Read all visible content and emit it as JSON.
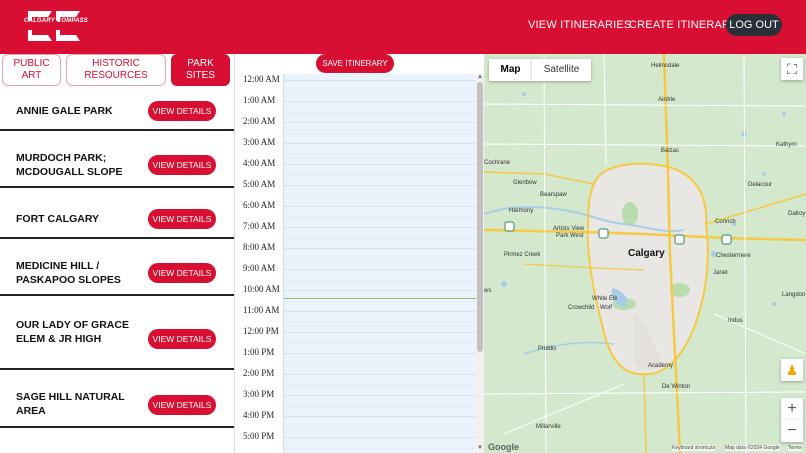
{
  "header": {
    "logo_text": "CALGARY COMPASS",
    "nav": {
      "view_itineraries": "VIEW ITINERARIES",
      "create_itinerary": "CREATE ITINERARY",
      "logout": "LOG OUT"
    },
    "colors": {
      "brand": "#d80f32",
      "logout_bg": "#2b2f3a"
    }
  },
  "tabs": [
    {
      "line1": "PUBLIC",
      "line2": "ART"
    },
    {
      "line1": "HISTORIC",
      "line2": "RESOURCES"
    },
    {
      "line1": "PARK",
      "line2": "SITES"
    }
  ],
  "sites": [
    {
      "name": "ANNIE GALE PARK",
      "button": "VIEW DETAILS"
    },
    {
      "name": "MURDOCH PARK; MCDOUGALL SLOPE",
      "button": "VIEW DETAILS"
    },
    {
      "name": "FORT CALGARY",
      "button": "VIEW DETAILS"
    },
    {
      "name": "MEDICINE HILL / PASKAPOO SLOPES",
      "button": "VIEW DETAILS"
    },
    {
      "name": "OUR LADY OF GRACE ELEM & JR HIGH",
      "button": "VIEW DETAILS"
    },
    {
      "name": "SAGE HILL NATURAL AREA",
      "button": "VIEW DETAILS"
    }
  ],
  "calendar": {
    "save_label": "SAVE ITINERARY",
    "times": [
      "12:00 AM",
      "1:00 AM",
      "2:00 AM",
      "3:00 AM",
      "4:00 AM",
      "5:00 AM",
      "6:00 AM",
      "7:00 AM",
      "8:00 AM",
      "9:00 AM",
      "10:00 AM",
      "11:00 AM",
      "12:00 PM",
      "1:00 PM",
      "2:00 PM",
      "3:00 PM",
      "4:00 PM",
      "5:00 PM"
    ]
  },
  "map": {
    "map_label": "Map",
    "satellite_label": "Satellite",
    "city": "Calgary",
    "towns": {
      "helmsdale": "Helmsdale",
      "airdrie": "Airdrie",
      "balzac": "Balzac",
      "cochrane": "Cochrane",
      "glenbow": "Glenbow",
      "bearspaw": "Bearspaw",
      "harmony": "Harmony",
      "artists_view": "Artists View",
      "park_west": "Park West",
      "pirmez_creek": "Pirmez Creek",
      "white_elk": "White Elk",
      "crowchild": "Crowchild",
      "wolf": "Wolf",
      "priddis": "Priddis",
      "academy": "Academy",
      "de_winton": "De Winton",
      "millarville": "Millarville",
      "kathyrn": "Kathyrn",
      "delacour": "Delacour",
      "conrich": "Conrich",
      "chestermere": "Chestermere",
      "janet": "Janet",
      "indus": "Indus",
      "langdon": "Langdon",
      "dalroy": "Dalroy",
      "ws": "ws"
    },
    "footer": {
      "google": "Google",
      "shortcuts": "Keyboard shortcuts",
      "data": "Map data ©2024 Google",
      "terms": "Terms"
    }
  }
}
